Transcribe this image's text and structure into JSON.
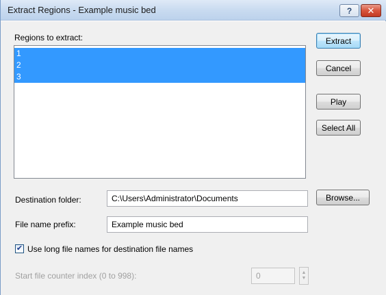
{
  "window": {
    "title": "Extract Regions - Example music bed",
    "help_label": "?",
    "close_label": "✕"
  },
  "regions": {
    "label": "Regions to extract:",
    "items": [
      "1",
      "2",
      "3"
    ]
  },
  "buttons": {
    "extract": "Extract",
    "cancel": "Cancel",
    "play": "Play",
    "select_all": "Select All",
    "browse": "Browse..."
  },
  "destination": {
    "label": "Destination folder:",
    "value": "C:\\Users\\Administrator\\Documents"
  },
  "prefix": {
    "label": "File name prefix:",
    "value": "Example music bed"
  },
  "long_names": {
    "label": "Use long file names for destination file names",
    "checked": true
  },
  "counter": {
    "label": "Start file counter index (0 to 998):",
    "value": "0",
    "enabled": false
  },
  "colors": {
    "selection": "#3399ff",
    "titlebar": "#c9dbf0",
    "close": "#d8553d"
  }
}
